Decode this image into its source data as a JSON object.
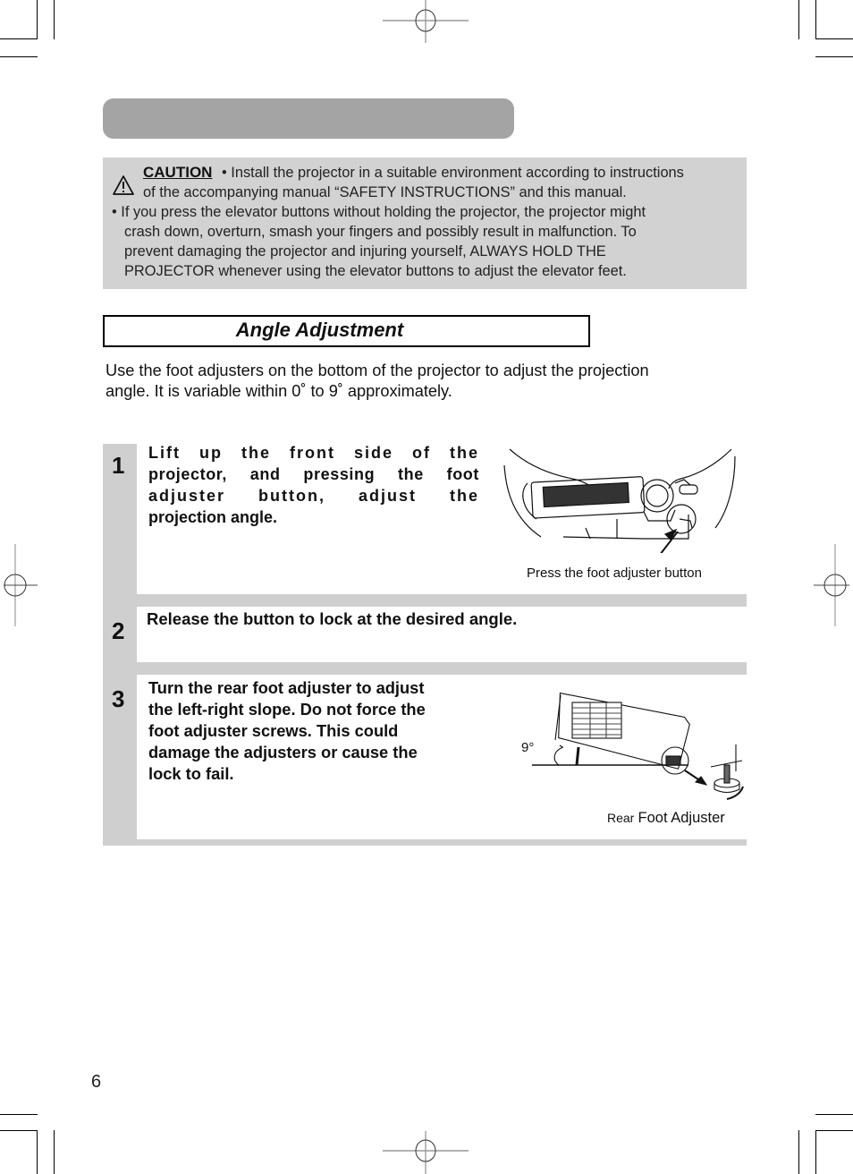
{
  "caution": {
    "label": "CAUTION",
    "icon": "warning-triangle-icon",
    "lines": [
      "• Install the projector in a suitable environment according to instructions",
      "of the accompanying manual “SAFETY INSTRUCTIONS” and this manual.",
      "• If you press the elevator buttons without holding the projector, the projector might",
      "crash down, overturn, smash your fingers and possibly result in malfunction. To",
      "prevent damaging the projector and injuring yourself, ALWAYS HOLD THE",
      "PROJECTOR whenever using the elevator buttons to adjust the elevator feet."
    ]
  },
  "section": {
    "title": "Angle Adjustment",
    "intro_lines": [
      "Use the foot adjusters on the bottom of the projector to adjust the projection",
      "angle. It is variable within 0˚ to 9˚ approximately."
    ]
  },
  "steps": [
    {
      "number": "1",
      "lines": [
        "Lift up the front side of the",
        "projector, and pressing the foot",
        "adjuster button, adjust the",
        "projection angle."
      ],
      "figure_caption": "Press the foot adjuster button"
    },
    {
      "number": "2",
      "lines": [
        "Release the button to lock at the desired angle."
      ]
    },
    {
      "number": "3",
      "lines": [
        "Turn the rear foot adjuster to adjust",
        "the left-right slope. Do not force the",
        "foot adjuster screws. This could",
        "damage the adjusters or cause the",
        "lock to fail."
      ],
      "figure_angle": "9°",
      "figure_caption_small": "Rear",
      "figure_caption": "Foot Adjuster"
    }
  ],
  "page_number": "6"
}
